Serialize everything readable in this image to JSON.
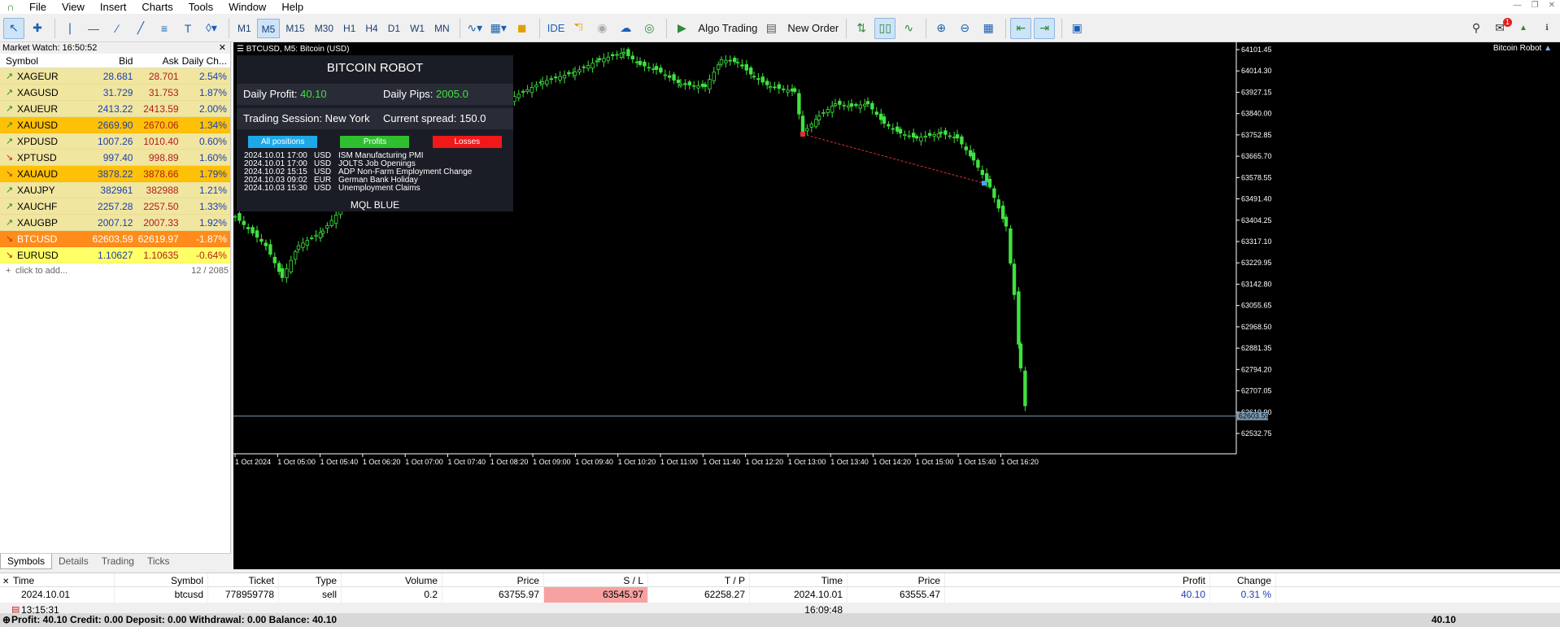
{
  "menu": {
    "items": [
      "File",
      "View",
      "Insert",
      "Charts",
      "Tools",
      "Window",
      "Help"
    ]
  },
  "toolbar": {
    "timeframes": [
      "M1",
      "M5",
      "M15",
      "M30",
      "H1",
      "H4",
      "D1",
      "W1",
      "MN"
    ],
    "selected_timeframe": "M5",
    "ide": "IDE",
    "algo_trading": "Algo Trading",
    "new_order": "New Order",
    "notifications": "1"
  },
  "market_watch": {
    "title": "Market Watch: 16:50:52",
    "columns": [
      "Symbol",
      "Bid",
      "Ask",
      "Daily Ch..."
    ],
    "rows": [
      {
        "symbol": "XAGEUR",
        "bid": "28.681",
        "ask": "28.701",
        "change": "2.54%",
        "dir": "up",
        "bg": "#f0e6a0"
      },
      {
        "symbol": "XAGUSD",
        "bid": "31.729",
        "ask": "31.753",
        "change": "1.87%",
        "dir": "up",
        "bg": "#f0e6a0"
      },
      {
        "symbol": "XAUEUR",
        "bid": "2413.22",
        "ask": "2413.59",
        "change": "2.00%",
        "dir": "up",
        "bg": "#f0e6a0"
      },
      {
        "symbol": "XAUUSD",
        "bid": "2669.90",
        "ask": "2670.06",
        "change": "1.34%",
        "dir": "up",
        "bg": "#ffc107"
      },
      {
        "symbol": "XPDUSD",
        "bid": "1007.26",
        "ask": "1010.40",
        "change": "0.60%",
        "dir": "up",
        "bg": "#f0e6a0"
      },
      {
        "symbol": "XPTUSD",
        "bid": "997.40",
        "ask": "998.89",
        "change": "1.60%",
        "dir": "down",
        "bg": "#f0e6a0"
      },
      {
        "symbol": "XAUAUD",
        "bid": "3878.22",
        "ask": "3878.66",
        "change": "1.79%",
        "dir": "down",
        "bg": "#ffc107"
      },
      {
        "symbol": "XAUJPY",
        "bid": "382961",
        "ask": "382988",
        "change": "1.21%",
        "dir": "up",
        "bg": "#f0e6a0"
      },
      {
        "symbol": "XAUCHF",
        "bid": "2257.28",
        "ask": "2257.50",
        "change": "1.33%",
        "dir": "up",
        "bg": "#f0e6a0"
      },
      {
        "symbol": "XAUGBP",
        "bid": "2007.12",
        "ask": "2007.33",
        "change": "1.92%",
        "dir": "up",
        "bg": "#f0e6a0"
      },
      {
        "symbol": "BTCUSD",
        "bid": "62603.59",
        "ask": "62619.97",
        "change": "-1.87%",
        "dir": "down",
        "bg": "#ff8c1a"
      },
      {
        "symbol": "EURUSD",
        "bid": "1.10627",
        "ask": "1.10635",
        "change": "-0.64%",
        "dir": "down",
        "bg": "#ffff66"
      }
    ],
    "add_label": "click to add...",
    "count": "12 / 2085",
    "tabs": [
      "Symbols",
      "Details",
      "Trading",
      "Ticks"
    ]
  },
  "chart": {
    "title": "BTCUSD, M5:  Bitcoin (USD)",
    "ea_label": "Bitcoin Robot",
    "current_price": "62603.59",
    "price_labels": [
      "64101.45",
      "64014.30",
      "63927.15",
      "63840.00",
      "63752.85",
      "63665.70",
      "63578.55",
      "63491.40",
      "63404.25",
      "63317.10",
      "63229.95",
      "63142.80",
      "63055.65",
      "62968.50",
      "62881.35",
      "62794.20",
      "62707.05",
      "62619.90",
      "62532.75"
    ],
    "time_labels": [
      "1 Oct 2024",
      "1 Oct 05:00",
      "1 Oct 05:40",
      "1 Oct 06:20",
      "1 Oct 07:00",
      "1 Oct 07:40",
      "1 Oct 08:20",
      "1 Oct 09:00",
      "1 Oct 09:40",
      "1 Oct 10:20",
      "1 Oct 11:00",
      "1 Oct 11:40",
      "1 Oct 12:20",
      "1 Oct 13:00",
      "1 Oct 13:40",
      "1 Oct 14:20",
      "1 Oct 15:00",
      "1 Oct 15:40",
      "1 Oct 16:20"
    ]
  },
  "robot_panel": {
    "title": "BITCOIN ROBOT",
    "daily_profit_label": "Daily Profit:",
    "daily_profit": "40.10",
    "daily_pips_label": "Daily Pips:",
    "daily_pips": "2005.0",
    "session_label": "Trading Session: New York",
    "spread_label": "Current spread:",
    "spread": "150.0",
    "buttons": {
      "all": "All positions",
      "profits": "Profits",
      "losses": "Losses"
    },
    "news": [
      {
        "date": "2024.10.01 17:00",
        "cur": "USD",
        "event": "ISM Manufacturing PMI"
      },
      {
        "date": "2024.10.01 17:00",
        "cur": "USD",
        "event": "JOLTS Job Openings"
      },
      {
        "date": "2024.10.02 15:15",
        "cur": "USD",
        "event": "ADP Non-Farm Employment Change"
      },
      {
        "date": "2024.10.03 09:02",
        "cur": "EUR",
        "event": "German Bank Holiday"
      },
      {
        "date": "2024.10.03 15:30",
        "cur": "USD",
        "event": "Unemployment Claims"
      }
    ],
    "footer": "MQL BLUE"
  },
  "trade": {
    "columns": [
      "Time",
      "Symbol",
      "Ticket",
      "Type",
      "Volume",
      "Price",
      "S / L",
      "T / P",
      "Time",
      "Price",
      "Profit",
      "Change"
    ],
    "row": {
      "time": "2024.10.01 13:15:31",
      "symbol": "btcusd",
      "ticket": "778959778",
      "type": "sell",
      "volume": "0.2",
      "price": "63755.97",
      "sl": "63545.97",
      "tp": "62258.27",
      "close_time": "2024.10.01 16:09:48",
      "close_price": "63555.47",
      "profit": "40.10",
      "change": "0.31 %"
    },
    "balance_line": "Profit: 40.10  Credit: 0.00  Deposit: 0.00  Withdrawal: 0.00  Balance: 40.10",
    "total_profit": "40.10"
  }
}
